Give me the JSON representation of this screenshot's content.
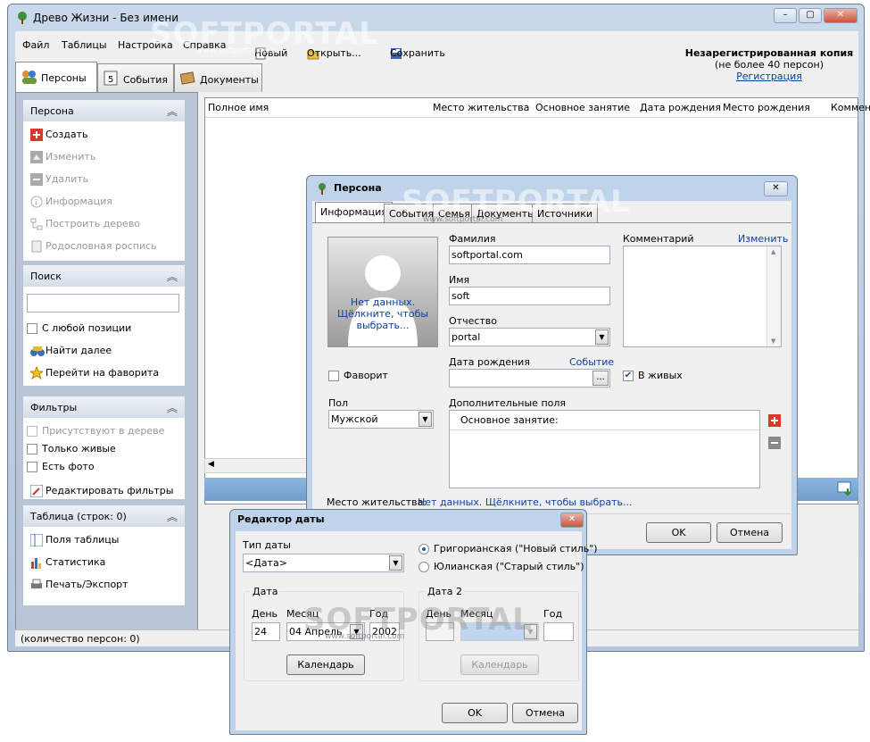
{
  "main": {
    "title": "Древо Жизни - Без имени",
    "menu": [
      "Файл",
      "Таблицы",
      "Настройка",
      "Справка"
    ],
    "toolbar": {
      "new_label": "Новый",
      "open_label": "Открыть...",
      "save_label": "Сохранить"
    },
    "registration": {
      "line1": "Незарегистрированная копия",
      "line2": "(не более 40 персон)",
      "link": "Регистрация"
    },
    "tabs": [
      "Персоны",
      "События",
      "Документы"
    ],
    "panels": {
      "person": {
        "title": "Персона",
        "items": [
          "Создать",
          "Изменить",
          "Удалить",
          "Информация",
          "Построить дерево",
          "Родословная роспись"
        ]
      },
      "search": {
        "title": "Поиск",
        "any_position": "С любой позиции",
        "find_next": "Найти далее",
        "goto_favorite": "Перейти на фаворита"
      },
      "filters": {
        "title": "Фильтры",
        "items": [
          "Присутствуют в дереве",
          "Только живые",
          "Есть фото"
        ],
        "edit": "Редактировать фильтры"
      },
      "table": {
        "title": "Таблица (строк: 0)",
        "items": [
          "Поля таблицы",
          "Статистика",
          "Печать/Экспорт"
        ]
      }
    },
    "grid_columns": [
      "Полное имя",
      "Место жительства",
      "Основное занятие",
      "Дата рождения",
      "Место рождения",
      "Коммент"
    ],
    "status": "(количество персон: 0)"
  },
  "person_dialog": {
    "title": "Персона",
    "tabs": [
      "Информация",
      "События",
      "Семья",
      "Документы",
      "Источники"
    ],
    "photo_text": "Нет данных. Щёлкните, чтобы выбрать...",
    "surname_label": "Фамилия",
    "surname": "softportal.com",
    "name_label": "Имя",
    "name": "soft",
    "patronymic_label": "Отчество",
    "patronymic": "portal",
    "comment_label": "Комментарий",
    "comment_edit": "Изменить",
    "favorite_label": "Фаворит",
    "birth_label": "Дата рождения",
    "birth_event": "Событие",
    "birth_btn": "...",
    "alive_label": "В живых",
    "gender_label": "Пол",
    "gender": "Мужской",
    "extra_label": "Дополнительные поля",
    "extra_field": "Основное занятие:",
    "residence_label": "Место жительства:",
    "residence_link": "Нет данных. Щёлкните, чтобы выбрать...",
    "ok": "OK",
    "cancel": "Отмена"
  },
  "date_editor": {
    "title": "Редактор даты",
    "type_label": "Тип даты",
    "type_value": "<Дата>",
    "gregorian": "Григорианская (\"Новый стиль\")",
    "julian": "Юлианская (\"Старый стиль\")",
    "date_group": "Дата",
    "date2_group": "Дата 2",
    "day_label": "День",
    "month_label": "Месяц",
    "year_label": "Год",
    "day": "24",
    "month": "04 Апрель",
    "year": "2002",
    "calendar": "Календарь",
    "ok": "OK",
    "cancel": "Отмена"
  },
  "watermark": "SOFTPORTAL",
  "watermark_url": "www.softportal.com"
}
